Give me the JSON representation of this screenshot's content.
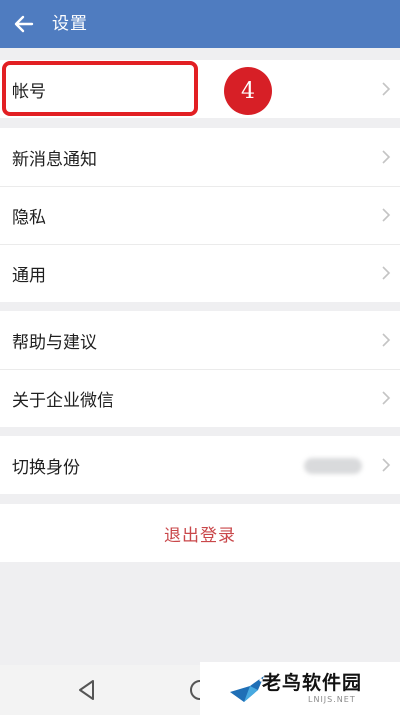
{
  "header": {
    "title": "设置"
  },
  "groups": [
    {
      "items": [
        {
          "label": "帐号"
        }
      ]
    },
    {
      "items": [
        {
          "label": "新消息通知"
        },
        {
          "label": "隐私"
        },
        {
          "label": "通用"
        }
      ]
    },
    {
      "items": [
        {
          "label": "帮助与建议"
        },
        {
          "label": "关于企业微信"
        }
      ]
    },
    {
      "items": [
        {
          "label": "切换身份"
        }
      ]
    }
  ],
  "annotation": {
    "step_number": "4"
  },
  "logout": {
    "label": "退出登录"
  },
  "watermark": {
    "text": "老鸟软件园",
    "subtext": "LNIJS.NET"
  },
  "colors": {
    "header": "#4f7cc0",
    "highlight": "#e21f23",
    "logout_text": "#c9474a"
  }
}
